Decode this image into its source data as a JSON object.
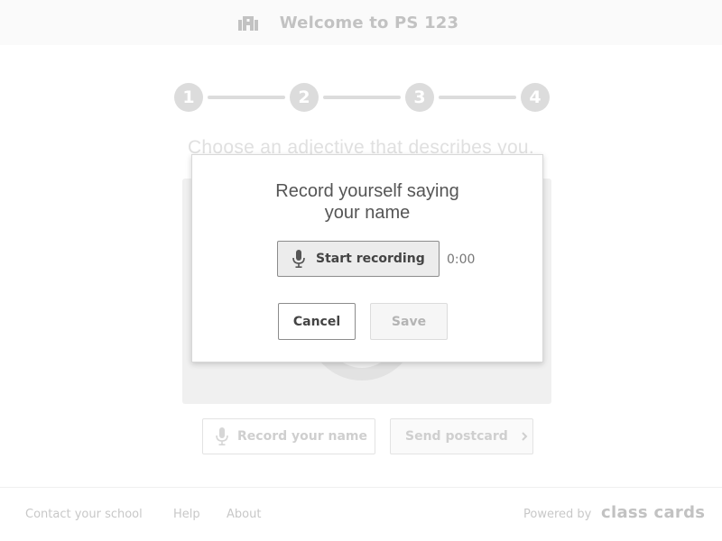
{
  "header": {
    "icon": "school-building-icon",
    "title": "Welcome to PS 123"
  },
  "stepper": {
    "steps": [
      "1",
      "2",
      "3",
      "4"
    ]
  },
  "main": {
    "prompt": "Choose an adjective that describes you.",
    "record_name_label": "Record your name",
    "send_postcard_label": "Send postcard"
  },
  "modal": {
    "title_line1": "Record yourself saying",
    "title_line2": "your name",
    "start_recording_label": "Start recording",
    "timer": "0:00",
    "cancel_label": "Cancel",
    "save_label": "Save"
  },
  "footer": {
    "links": [
      "Contact your school",
      "Help",
      "About"
    ],
    "powered_by": "Powered by",
    "brand": "class cards"
  }
}
